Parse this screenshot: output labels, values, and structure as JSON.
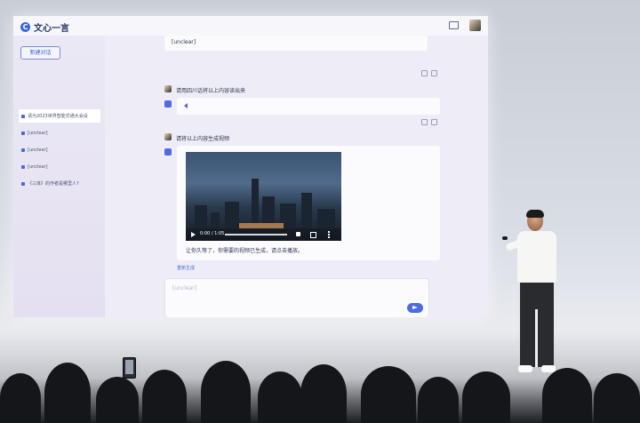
{
  "app": {
    "name": "文心一言",
    "top_link": "",
    "accent": "#4c69e2"
  },
  "sidebar": {
    "new_chat_label": "新建对话",
    "history_search": "",
    "items": [
      {
        "label": "请为2023世界智能交通大会设",
        "active": true
      },
      {
        "label": "[unclear]",
        "active": false
      },
      {
        "label": "[unclear]",
        "active": false
      },
      {
        "label": "[unclear]",
        "active": false
      },
      {
        "label": "《三体》的作者是哪里人?",
        "active": false
      }
    ]
  },
  "messages": [
    {
      "role": "bot",
      "text": "[unclear]"
    },
    {
      "role": "user",
      "text": "请用四川话将以上内容读出来"
    },
    {
      "role": "bot",
      "type": "audio"
    },
    {
      "role": "user",
      "text": "请将以上内容生成视频"
    },
    {
      "role": "bot",
      "type": "video",
      "video_time": "0:00 / 1:05",
      "caption": "让你久等了，你需要的视频已生成，请点击播放。",
      "regenerate_label": "重新生成"
    }
  ],
  "composer": {
    "placeholder": "[unclear]"
  },
  "icons": {
    "logo": "logo-icon",
    "mail": "mail-icon",
    "thumb_up": "thumb-up-icon",
    "thumb_down": "thumb-down-icon",
    "speaker": "speaker-icon",
    "play": "play-icon",
    "send": "send-icon"
  }
}
